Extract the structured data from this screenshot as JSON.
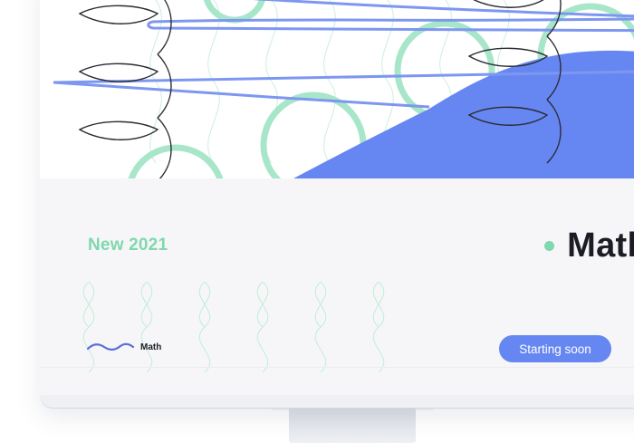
{
  "card": {
    "badge": "New 2021",
    "title": "Math",
    "tag_label": "Math",
    "cta_label": "Starting soon"
  },
  "colors": {
    "accent_blue": "#6687f2",
    "accent_green": "#7fd8ad",
    "text_dark": "#1c1c24",
    "screen_bg": "#f6f6f8"
  },
  "icons": {
    "status_dot": "green-dot-icon",
    "tag_wave": "wavy-line-icon"
  }
}
